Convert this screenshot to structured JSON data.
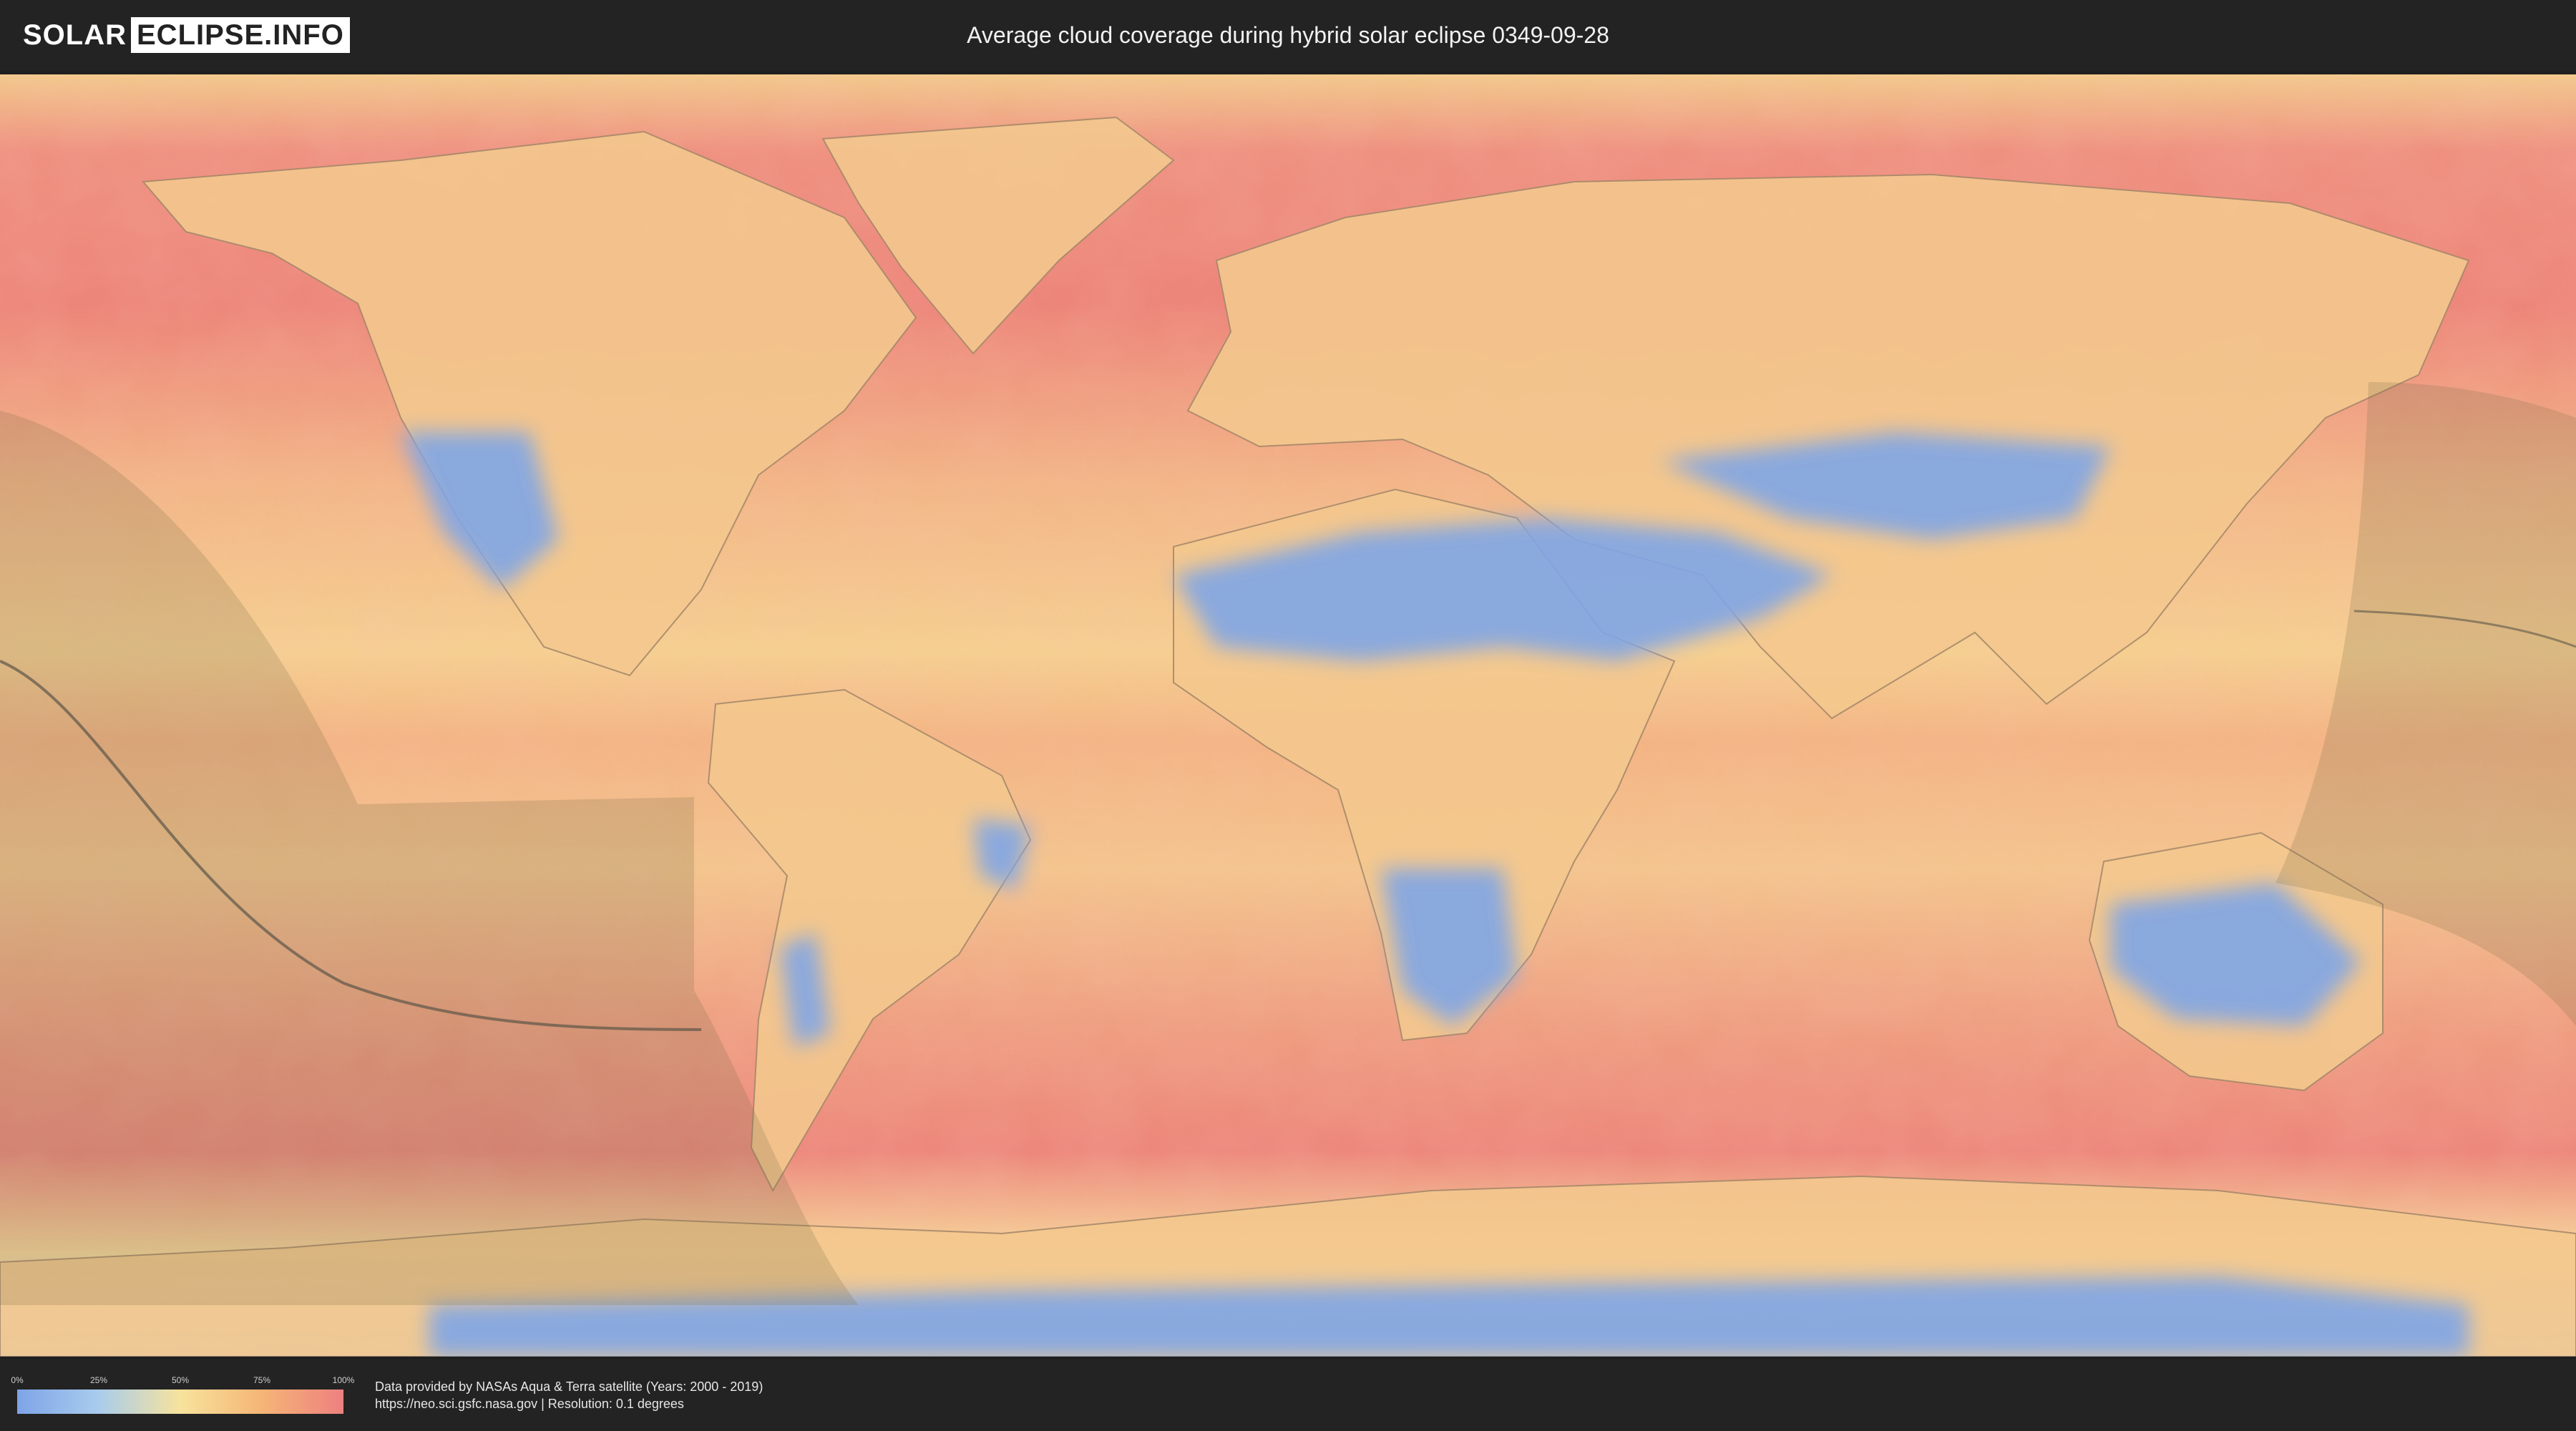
{
  "header": {
    "logo_part1": "SOLAR",
    "logo_part2": "ECLIPSE.INFO",
    "title": "Average cloud coverage during hybrid solar eclipse 0349-09-28"
  },
  "legend": {
    "ticks": [
      "0%",
      "25%",
      "50%",
      "75%",
      "100%"
    ],
    "colors": [
      "#7ea4e8",
      "#a9ccec",
      "#f7e39c",
      "#f5b576",
      "#ee8080"
    ]
  },
  "footer": {
    "credit_line1": "Data provided by NASAs Aqua & Terra satellite (Years: 2000 - 2019)",
    "credit_line2": "https://neo.sci.gsfc.nasa.gov | Resolution: 0.1 degrees"
  },
  "map": {
    "projection": "equirectangular",
    "layer": "average cloud coverage",
    "overlay": "eclipse visibility shading with central path"
  }
}
